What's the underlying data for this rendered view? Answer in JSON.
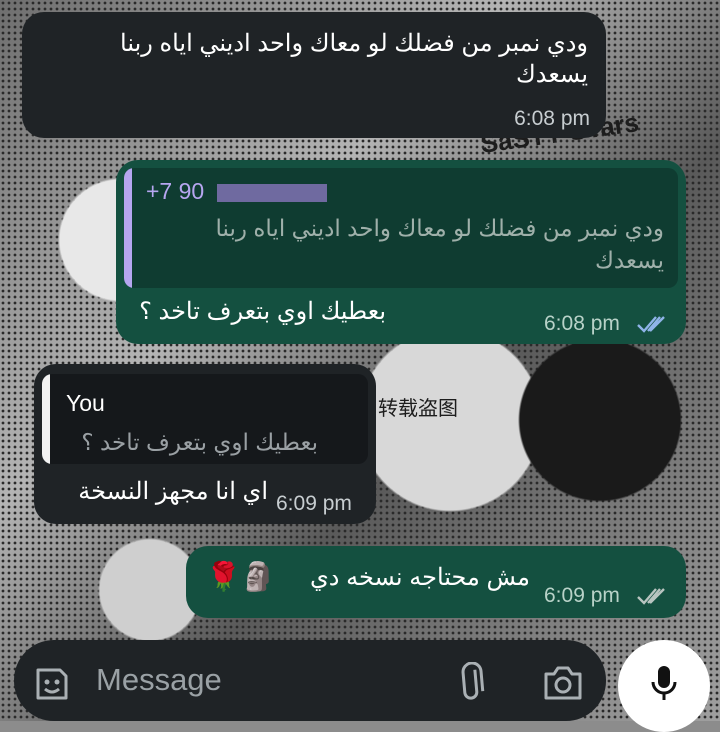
{
  "messages": [
    {
      "direction": "incoming",
      "text_line1": "ودي نمبر من فضلك لو معاك واحد اديني اياه ربنا",
      "text_line2": "يسعدك",
      "time": "6:08 pm"
    },
    {
      "direction": "outgoing",
      "quote": {
        "sender": "+7 90",
        "quote_line1": "ودي نمبر من فضلك لو معاك واحد اديني اياه ربنا",
        "quote_line2": "يسعدك"
      },
      "text": "بعطيك اوي بتعرف تاخد ؟",
      "time": "6:08 pm",
      "status": "read"
    },
    {
      "direction": "incoming",
      "quote": {
        "sender": "You",
        "quote_text": "بعطيك اوي بتعرف تاخد ؟"
      },
      "text": "اي انا مجهز النسخة",
      "time": "6:09 pm"
    },
    {
      "direction": "outgoing",
      "text": "مش محتاجه نسخه دي",
      "emojis": "🌹🗿",
      "time": "6:09 pm",
      "status": "read"
    }
  ],
  "wallpaper_text": {
    "stars": "SaSTY STars",
    "cn": "转载盗图"
  },
  "composer": {
    "placeholder": "Message"
  },
  "icons": {
    "sticker": "sticker-icon",
    "attach": "paperclip-icon",
    "camera": "camera-icon",
    "mic": "microphone-icon",
    "ticks": "double-check-icon"
  },
  "colors": {
    "incoming": "#1f2326",
    "outgoing": "#145040",
    "tick": "#8fb4e8"
  }
}
